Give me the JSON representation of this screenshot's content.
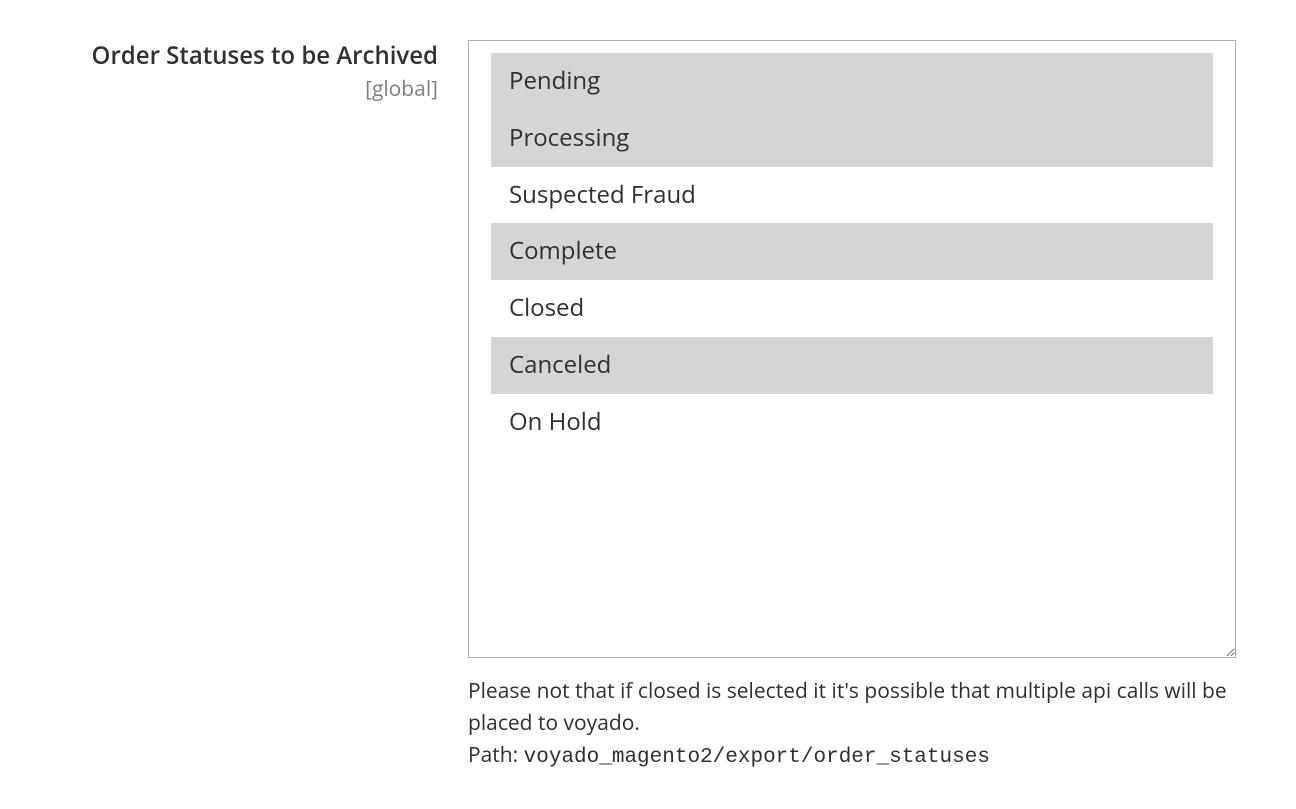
{
  "field": {
    "label": "Order Statuses to be Archived",
    "scope": "[global]",
    "options": [
      {
        "label": "Pending",
        "selected": true
      },
      {
        "label": "Processing",
        "selected": true
      },
      {
        "label": "Suspected Fraud",
        "selected": false
      },
      {
        "label": "Complete",
        "selected": true
      },
      {
        "label": "Closed",
        "selected": false
      },
      {
        "label": "Canceled",
        "selected": true
      },
      {
        "label": "On Hold",
        "selected": false
      }
    ],
    "note": "Please not that if closed is selected it it's possible that multiple api calls will be placed to voyado.",
    "path_label": "Path: ",
    "path_value": "voyado_magento2/export/order_statuses"
  }
}
